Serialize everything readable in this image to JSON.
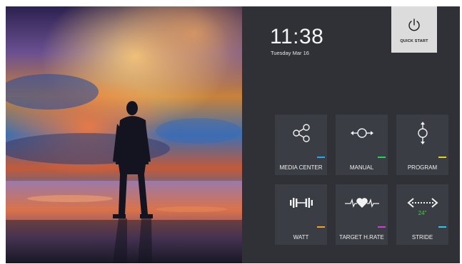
{
  "clock": {
    "time": "11:38",
    "date": "Tuesday Mar 16"
  },
  "quick_start": {
    "label": "QUICK START",
    "icon": "power-icon"
  },
  "tiles": [
    {
      "label": "MEDIA CENTER",
      "icon": "share-nodes-icon",
      "accent": "#2aa7e6"
    },
    {
      "label": "MANUAL",
      "icon": "manual-arrows-icon",
      "accent": "#23d35a"
    },
    {
      "label": "PROGRAM",
      "icon": "program-arrows-icon",
      "accent": "#e4d22a"
    },
    {
      "label": "WATT",
      "icon": "dumbbell-icon",
      "accent": "#f2a22a"
    },
    {
      "label": "TARGET H.RATE",
      "icon": "heart-rate-icon",
      "accent": "#d53bd6"
    },
    {
      "label": "STRIDE",
      "icon": "stride-arrows-icon",
      "accent": "#2ec6ea",
      "value": "24\""
    }
  ],
  "colors": {
    "panel": "#2f3136",
    "tile": "#3a3d43",
    "quick_start_bg": "#dcdcdc",
    "stride_value": "#3fd33f"
  }
}
